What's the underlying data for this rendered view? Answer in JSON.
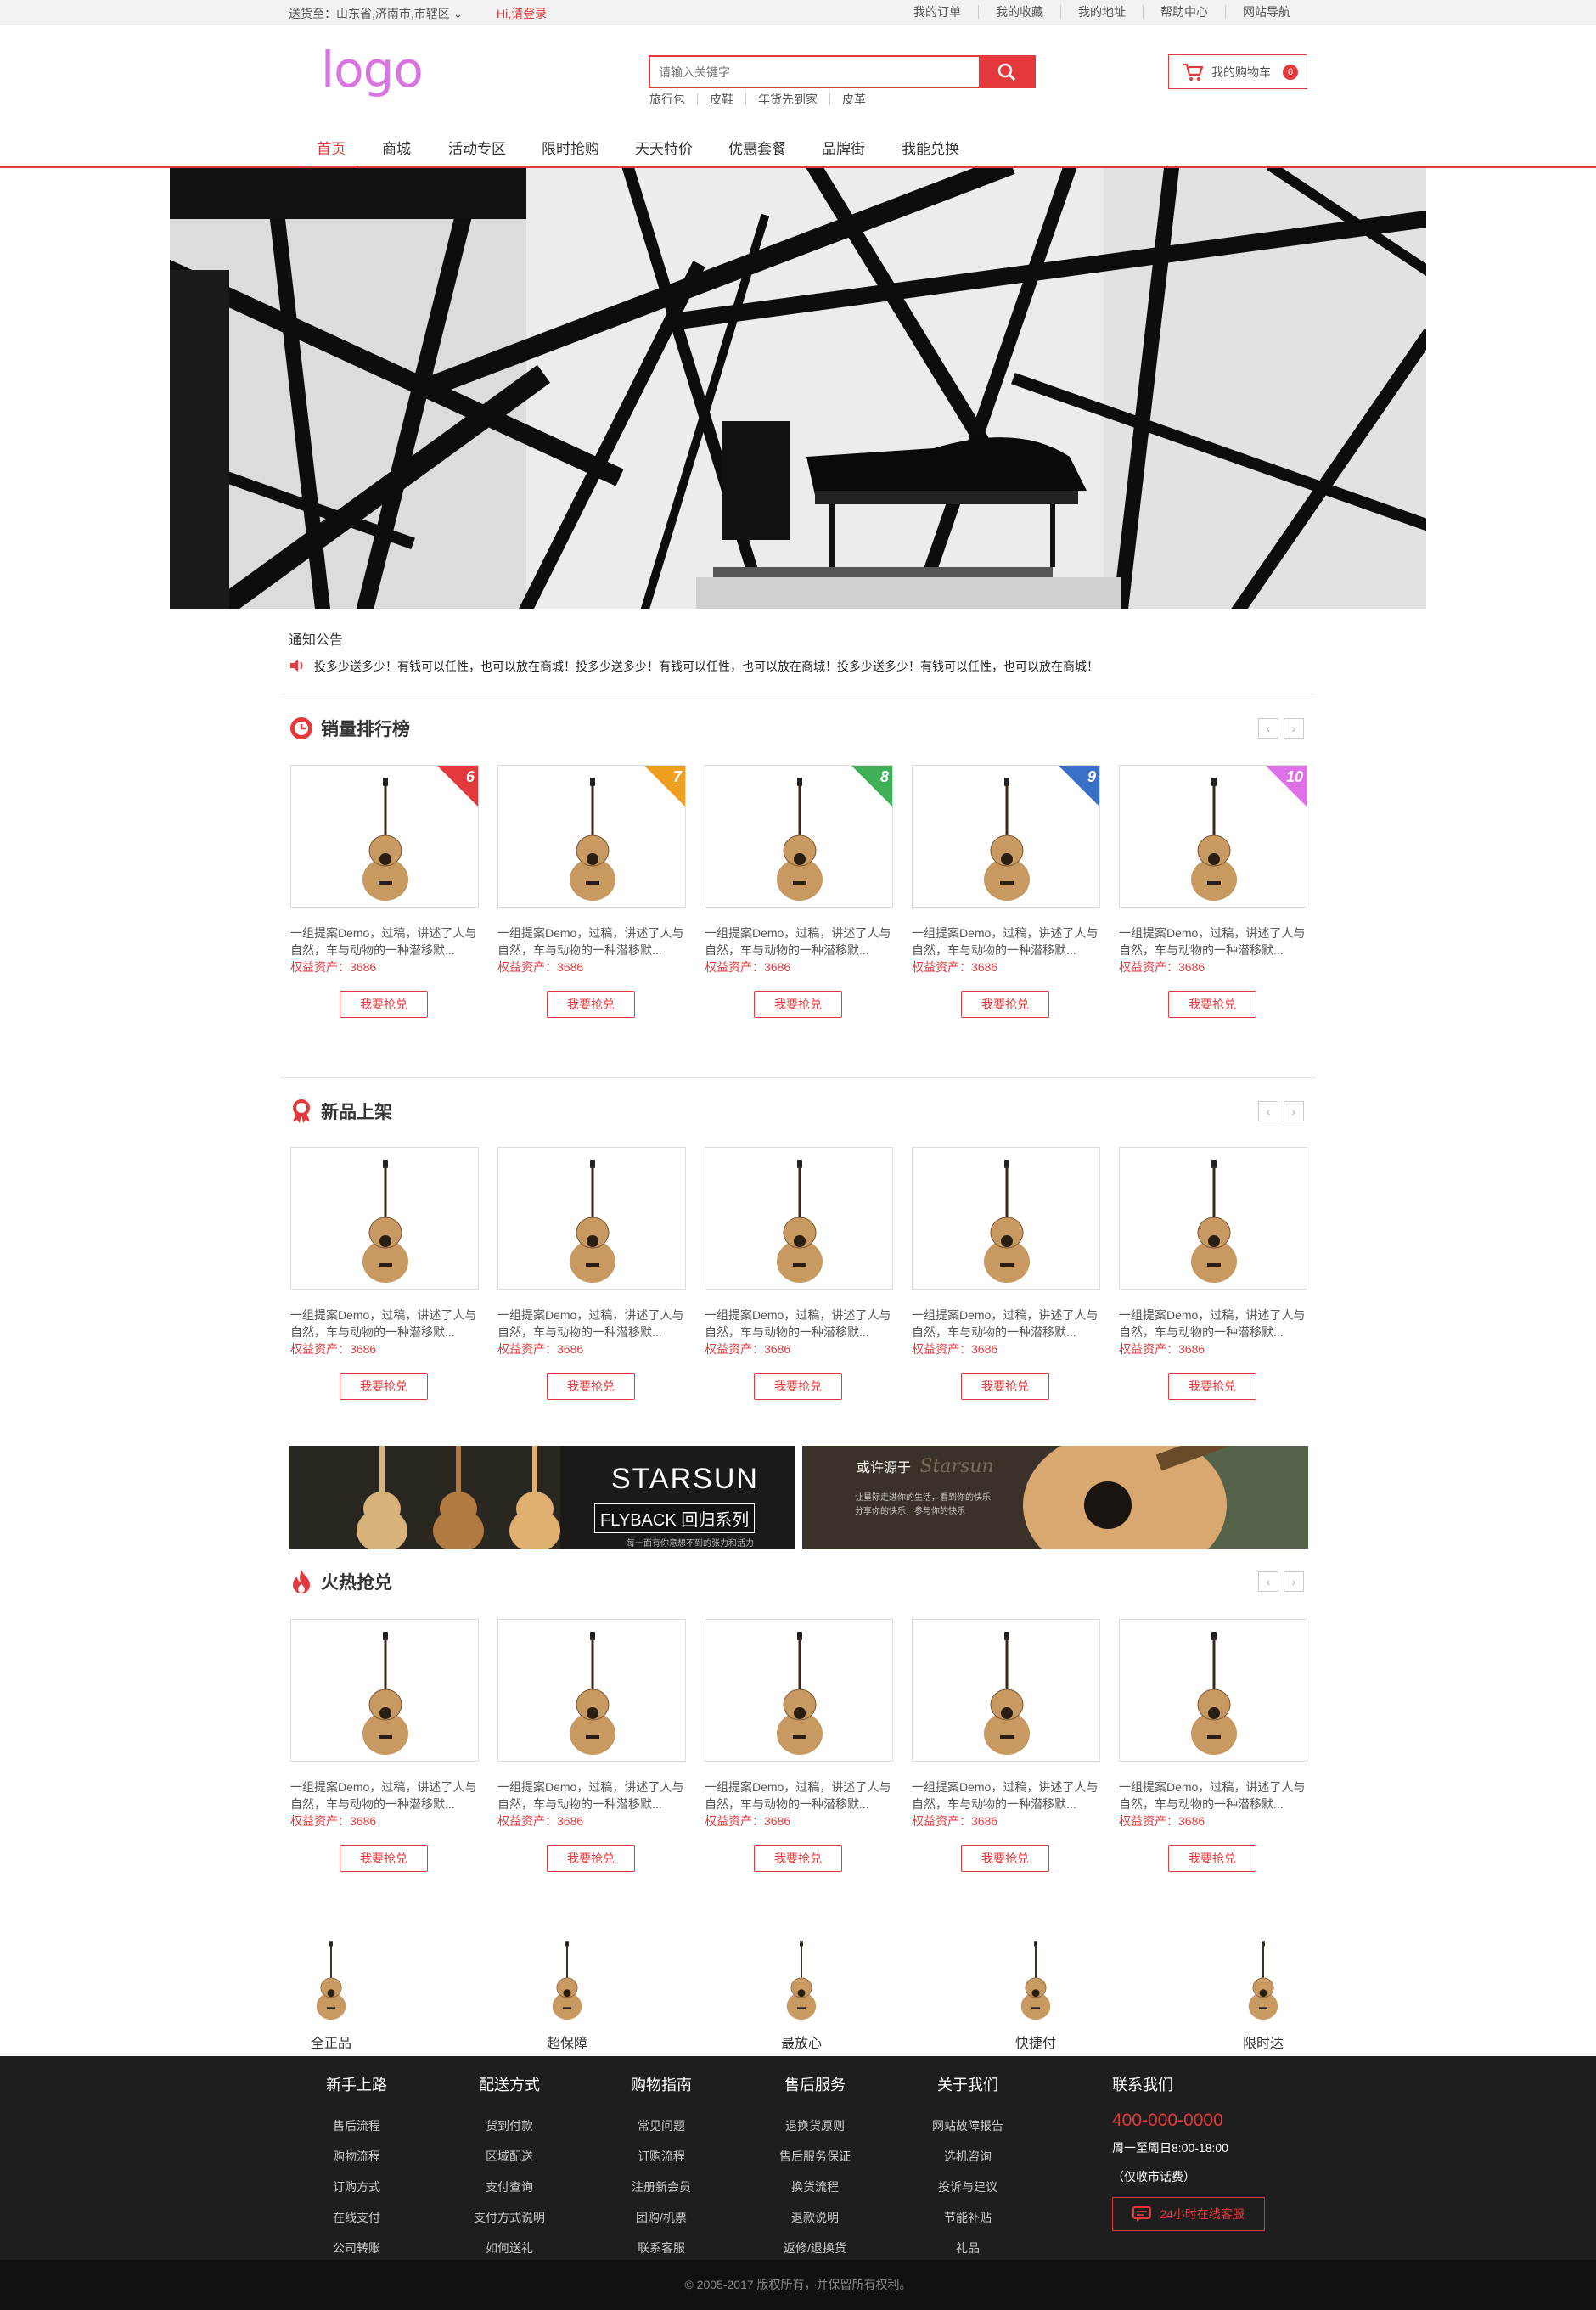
{
  "topbar": {
    "ship_to": "送货至：山东省,济南市,市辖区",
    "login": "Hi,请登录",
    "links": [
      "我的订单",
      "我的收藏",
      "我的地址",
      "帮助中心",
      "网站导航"
    ]
  },
  "header": {
    "logo": "logo",
    "search_placeholder": "请输入关键字",
    "hot_words": [
      "旅行包",
      "皮鞋",
      "年货先到家",
      "皮革"
    ],
    "cart_label": "我的购物车",
    "cart_count": "0"
  },
  "nav": [
    "首页",
    "商城",
    "活动专区",
    "限时抢购",
    "天天特价",
    "优惠套餐",
    "品牌街",
    "我能兑换"
  ],
  "notice": {
    "title": "通知公告",
    "text": "投多少送多少！有钱可以任性，也可以放在商城！投多少送多少！有钱可以任性，也可以放在商城！投多少送多少！有钱可以任性，也可以放在商城！"
  },
  "sections": [
    {
      "title": "销量排行榜",
      "products": [
        {
          "rank": "6",
          "desc": "一组提案Demo，过稿，讲述了人与自然，车与动物的一种潜移默...",
          "price": "权益资产：3686",
          "buy": "我要抢兑"
        },
        {
          "rank": "7",
          "desc": "一组提案Demo，过稿，讲述了人与自然，车与动物的一种潜移默...",
          "price": "权益资产：3686",
          "buy": "我要抢兑"
        },
        {
          "rank": "8",
          "desc": "一组提案Demo，过稿，讲述了人与自然，车与动物的一种潜移默...",
          "price": "权益资产：3686",
          "buy": "我要抢兑"
        },
        {
          "rank": "9",
          "desc": "一组提案Demo，过稿，讲述了人与自然，车与动物的一种潜移默...",
          "price": "权益资产：3686",
          "buy": "我要抢兑"
        },
        {
          "rank": "10",
          "desc": "一组提案Demo，过稿，讲述了人与自然，车与动物的一种潜移默...",
          "price": "权益资产：3686",
          "buy": "我要抢兑"
        }
      ]
    },
    {
      "title": "新品上架",
      "products": [
        {
          "desc": "一组提案Demo，过稿，讲述了人与自然，车与动物的一种潜移默...",
          "price": "权益资产：3686",
          "buy": "我要抢兑"
        },
        {
          "desc": "一组提案Demo，过稿，讲述了人与自然，车与动物的一种潜移默...",
          "price": "权益资产：3686",
          "buy": "我要抢兑"
        },
        {
          "desc": "一组提案Demo，过稿，讲述了人与自然，车与动物的一种潜移默...",
          "price": "权益资产：3686",
          "buy": "我要抢兑"
        },
        {
          "desc": "一组提案Demo，过稿，讲述了人与自然，车与动物的一种潜移默...",
          "price": "权益资产：3686",
          "buy": "我要抢兑"
        },
        {
          "desc": "一组提案Demo，过稿，讲述了人与自然，车与动物的一种潜移默...",
          "price": "权益资产：3686",
          "buy": "我要抢兑"
        }
      ]
    },
    {
      "title": "火热抢兑",
      "products": [
        {
          "desc": "一组提案Demo，过稿，讲述了人与自然，车与动物的一种潜移默...",
          "price": "权益资产：3686",
          "buy": "我要抢兑"
        },
        {
          "desc": "一组提案Demo，过稿，讲述了人与自然，车与动物的一种潜移默...",
          "price": "权益资产：3686",
          "buy": "我要抢兑"
        },
        {
          "desc": "一组提案Demo，过稿，讲述了人与自然，车与动物的一种潜移默...",
          "price": "权益资产：3686",
          "buy": "我要抢兑"
        },
        {
          "desc": "一组提案Demo，过稿，讲述了人与自然，车与动物的一种潜移默...",
          "price": "权益资产：3686",
          "buy": "我要抢兑"
        },
        {
          "desc": "一组提案Demo，过稿，讲述了人与自然，车与动物的一种潜移默...",
          "price": "权益资产：3686",
          "buy": "我要抢兑"
        }
      ]
    }
  ],
  "promos": [
    {
      "title": "STARSUN",
      "subtitle": "FLYBACK 回归系列",
      "tagline": "每一面有你意想不到的张力和活力"
    },
    {
      "title": "或许源于",
      "brand": "Starsun",
      "line1": "让星际走进你的生活，看到你的快乐",
      "line2": "分享你的快乐，参与你的快乐"
    }
  ],
  "features": [
    "全正品",
    "超保障",
    "最放心",
    "快捷付",
    "限时达"
  ],
  "footer": {
    "columns": [
      {
        "title": "新手上路",
        "items": [
          "售后流程",
          "购物流程",
          "订购方式",
          "在线支付",
          "公司转账"
        ]
      },
      {
        "title": "配送方式",
        "items": [
          "货到付款",
          "区域配送",
          "支付查询",
          "支付方式说明",
          "如何送礼"
        ]
      },
      {
        "title": "购物指南",
        "items": [
          "常见问题",
          "订购流程",
          "注册新会员",
          "团购/机票",
          "联系客服"
        ]
      },
      {
        "title": "售后服务",
        "items": [
          "退换货原则",
          "售后服务保证",
          "换货流程",
          "退款说明",
          "返修/退换货"
        ]
      },
      {
        "title": "关于我们",
        "items": [
          "网站故障报告",
          "选机咨询",
          "投诉与建议",
          "节能补贴",
          "礼品"
        ]
      }
    ],
    "contact": {
      "title": "联系我们",
      "phone": "400-000-0000",
      "hours": "周一至周日8:00-18:00",
      "fee": "（仅收市话费）",
      "service": "24小时在线客服"
    },
    "copyright": "© 2005-2017 版权所有，并保留所有权利。"
  },
  "colors": {
    "accent": "#e4393c",
    "logo": "#d875e0",
    "footer_bg": "#1e1e1e"
  },
  "rank_colors": [
    "#e4393c",
    "#f0a020",
    "#3fb055",
    "#3870c8",
    "#e070e8"
  ]
}
